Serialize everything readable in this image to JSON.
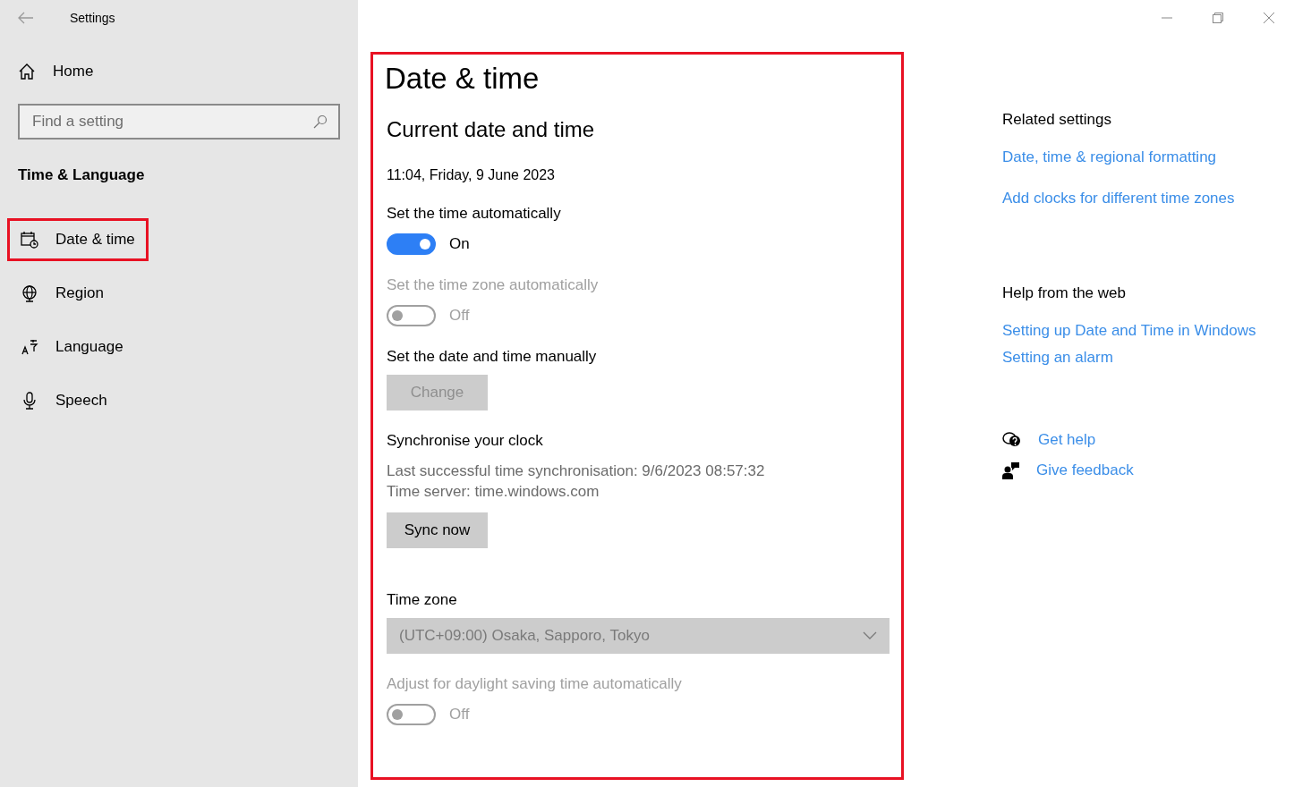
{
  "window": {
    "title": "Settings"
  },
  "sidebar": {
    "home": "Home",
    "search": {
      "placeholder": "Find a setting"
    },
    "section_title": "Time & Language",
    "items": [
      {
        "label": "Date & time",
        "kind": "calendar",
        "highlighted": true
      },
      {
        "label": "Region",
        "kind": "globe",
        "highlighted": false
      },
      {
        "label": "Language",
        "kind": "language",
        "highlighted": false
      },
      {
        "label": "Speech",
        "kind": "microphone",
        "highlighted": false
      }
    ]
  },
  "main": {
    "highlighted": true,
    "title": "Date & time",
    "subtitle": "Current date and time",
    "current": "11:04, Friday, 9 June 2023",
    "sections": [
      {
        "kind": "toggle",
        "label": "Set the time automatically",
        "on": true,
        "disabled": false,
        "state_text": "On"
      },
      {
        "kind": "toggle",
        "label": "Set the time zone automatically",
        "on": false,
        "disabled": true,
        "state_text": "Off"
      },
      {
        "kind": "button",
        "label": "Set the date and time manually",
        "button": "Change",
        "disabled": true
      },
      {
        "kind": "sync",
        "label": "Synchronise your clock",
        "lines": [
          "Last successful time synchronisation: 9/6/2023 08:57:32",
          "Time server: time.windows.com"
        ],
        "button": "Sync now",
        "disabled": false
      },
      {
        "kind": "dropdown",
        "label": "Time zone",
        "value": "(UTC+09:00) Osaka, Sapporo, Tokyo",
        "disabled": true
      },
      {
        "kind": "toggle",
        "label": "Adjust for daylight saving time automatically",
        "on": false,
        "disabled": true,
        "state_text": "Off"
      }
    ]
  },
  "related": {
    "groups": [
      {
        "title": "Related settings",
        "links": [
          "Date, time & regional formatting",
          "Add clocks for different time zones"
        ]
      },
      {
        "title": "Help from the web",
        "links": [
          "Setting up Date and Time in Windows",
          "Setting an alarm"
        ]
      }
    ],
    "actions": [
      {
        "label": "Get help",
        "kind": "help"
      },
      {
        "label": "Give feedback",
        "kind": "feedback"
      }
    ]
  }
}
